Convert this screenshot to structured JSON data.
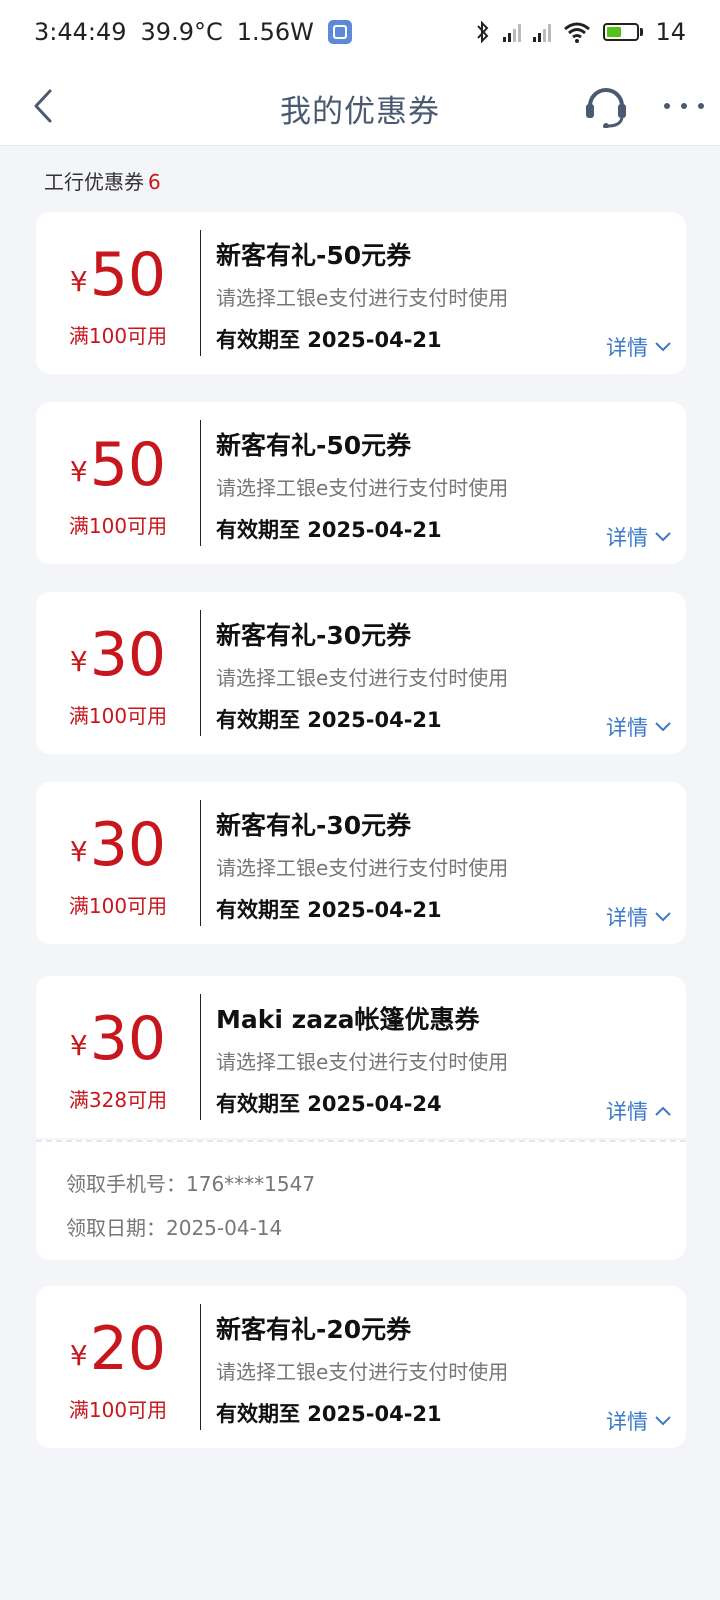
{
  "status": {
    "time": "3:44:49",
    "temp": "39.9°C",
    "power": "1.56W",
    "battery": "14"
  },
  "header": {
    "title": "我的优惠券"
  },
  "section": {
    "label": "工行优惠券",
    "count": "6"
  },
  "coupons": [
    {
      "currency": "¥",
      "amount": "50",
      "condition": "满100可用",
      "title": "新客有礼-50元券",
      "desc": "请选择工银e支付进行支付时使用",
      "expiry": "有效期至 2025-04-21",
      "detail": "详情"
    },
    {
      "currency": "¥",
      "amount": "50",
      "condition": "满100可用",
      "title": "新客有礼-50元券",
      "desc": "请选择工银e支付进行支付时使用",
      "expiry": "有效期至 2025-04-21",
      "detail": "详情"
    },
    {
      "currency": "¥",
      "amount": "30",
      "condition": "满100可用",
      "title": "新客有礼-30元券",
      "desc": "请选择工银e支付进行支付时使用",
      "expiry": "有效期至 2025-04-21",
      "detail": "详情"
    },
    {
      "currency": "¥",
      "amount": "30",
      "condition": "满100可用",
      "title": "新客有礼-30元券",
      "desc": "请选择工银e支付进行支付时使用",
      "expiry": "有效期至 2025-04-21",
      "detail": "详情"
    },
    {
      "currency": "¥",
      "amount": "30",
      "condition": "满328可用",
      "title": "Maki zaza帐篷优惠券",
      "desc": "请选择工银e支付进行支付时使用",
      "expiry": "有效期至 2025-04-24",
      "detail": "详情"
    },
    {
      "currency": "¥",
      "amount": "20",
      "condition": "满100可用",
      "title": "新客有礼-20元券",
      "desc": "请选择工银e支付进行支付时使用",
      "expiry": "有效期至 2025-04-21",
      "detail": "详情"
    }
  ],
  "expanded_detail": {
    "phone": "领取手机号：176****1547",
    "date": "领取日期：2025-04-14"
  },
  "colors": {
    "accent_red": "#c8161d",
    "link_blue": "#3b79c9",
    "header_text": "#4a5a70"
  }
}
